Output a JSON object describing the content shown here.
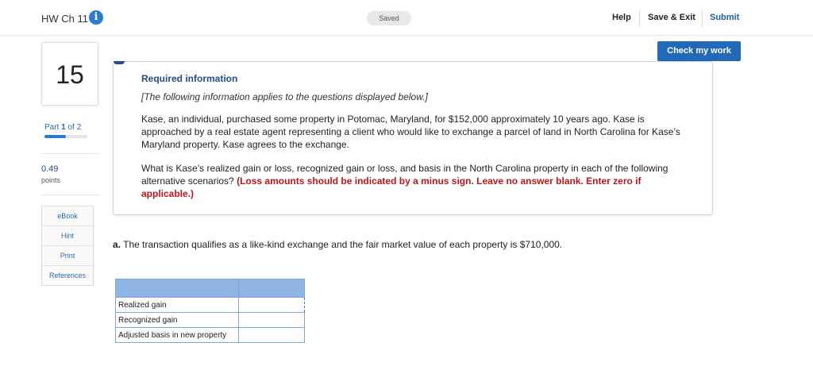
{
  "header": {
    "title": "HW Ch 11",
    "saved_label": "Saved",
    "help_label": "Help",
    "save_exit_label": "Save & Exit",
    "submit_label": "Submit",
    "check_work_label": "Check my work"
  },
  "sidebar": {
    "question_number": "15",
    "part_prefix": "Part",
    "part_current": "1",
    "part_of": "of 2",
    "part_progress": 0.5,
    "points_value": "0.49",
    "points_label": "points",
    "resources": [
      {
        "label": "eBook"
      },
      {
        "label": "Hint"
      },
      {
        "label": "Print"
      },
      {
        "label": "References"
      }
    ]
  },
  "card": {
    "title": "Required information",
    "subtitle": "[The following information applies to the questions displayed below.]",
    "paragraph1": "Kase, an individual, purchased some property in Potomac, Maryland, for $152,000 approximately 10 years ago. Kase is approached by a real estate agent representing a client who would like to exchange a parcel of land in North Carolina for Kase’s Maryland property. Kase agrees to the exchange.",
    "paragraph2_plain": "What is Kase’s realized gain or loss, recognized gain or loss, and basis in the North Carolina property in each of the following alternative scenarios?",
    "paragraph2_red": "(Loss amounts should be indicated by a minus sign. Leave no answer blank. Enter zero if applicable.)"
  },
  "question": {
    "part_label": "a.",
    "text": "The transaction qualifies as a like-kind exchange and the fair market value of each property is $710,000."
  },
  "table": {
    "rows": [
      {
        "label": "Realized gain",
        "value": ""
      },
      {
        "label": "Recognized gain",
        "value": ""
      },
      {
        "label": "Adjusted basis in new property",
        "value": ""
      }
    ]
  },
  "colors": {
    "accent": "#2269b8",
    "title_blue": "#1f4e8c",
    "warning_red": "#c0161b",
    "table_header": "#8db4e2"
  }
}
